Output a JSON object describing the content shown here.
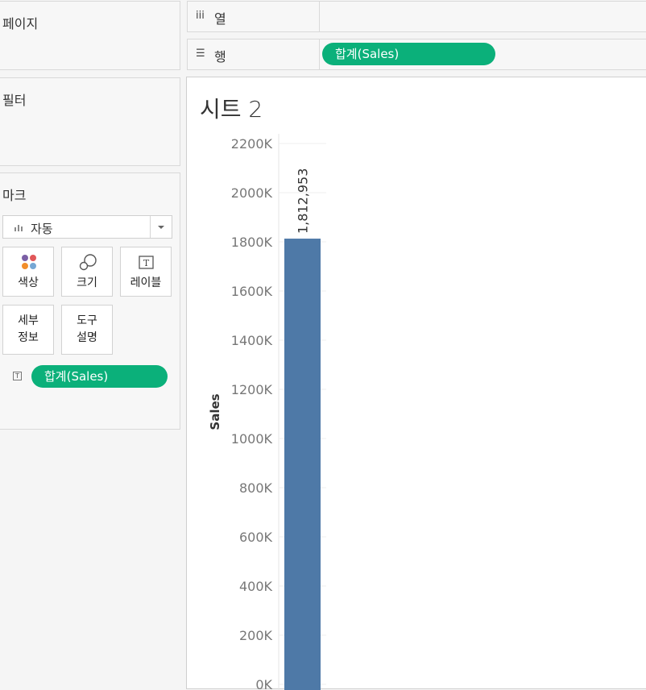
{
  "left_panel": {
    "pages_title": "페이지",
    "filters_title": "필터",
    "marks": {
      "title": "마크",
      "mark_type": "자동",
      "cards": {
        "color": "색상",
        "size": "크기",
        "label": "레이블",
        "detail_line1": "세부",
        "detail_line2": "정보",
        "tooltip_line1": "도구",
        "tooltip_line2": "설명"
      },
      "label_pill": "합계(Sales)"
    }
  },
  "shelves": {
    "columns_label": "열",
    "rows_label": "행",
    "rows_pill": "합계(Sales)"
  },
  "sheet": {
    "title": "시트 2"
  },
  "chart_data": {
    "type": "bar",
    "categories": [
      ""
    ],
    "values": [
      1812953
    ],
    "data_labels": [
      "1,812,953"
    ],
    "ylabel": "Sales",
    "yticks": [
      "0K",
      "200K",
      "400K",
      "600K",
      "800K",
      "1000K",
      "1200K",
      "1400K",
      "1600K",
      "1800K",
      "2000K",
      "2200K"
    ],
    "ylim": [
      0,
      2200000
    ],
    "bar_color": "#4e79a7",
    "grid": true
  },
  "colors": {
    "pill": "#0bb07a",
    "bar": "#4e79a7"
  }
}
